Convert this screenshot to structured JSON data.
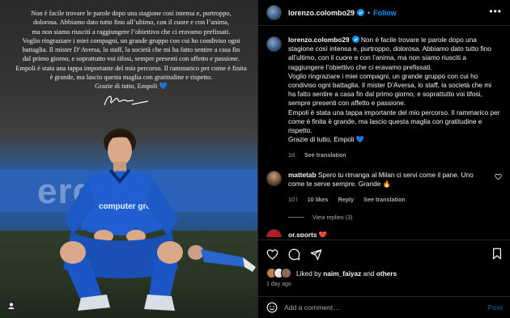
{
  "photo": {
    "overlay_text": "Non è facile trovare le parole dopo una stagione così intensa e, purtroppo,\ndolorosa. Abbiamo dato tutto fino all’ultimo, con il cuore e con l’anima,\nma non siamo riusciti a raggiungere l’obiettivo che ci eravamo prefissati.\nVoglio ringraziare i miei compagni, un grande gruppo con cui ho condiviso ogni\nbattaglia. Il mister D’Aversa, lo staff, la società che mi ha fatto sentire a casa fin\ndal primo giorno, e soprattutto voi tifosi, sempre presenti con affetto e passione.\nEmpoli è stata una tappa importante del mio percorso. Il rammarico per come è finita\nè grande, ma lascio questa maglia con gratitudine e rispetto.\nGrazie di tutto, Empoli 💙",
    "banner_text": "ergass",
    "shirt_sponsor": "computer gross"
  },
  "header": {
    "username": "lorenzo.colombo29",
    "separator": "•",
    "follow_label": "Follow",
    "more_label": "•••"
  },
  "caption": {
    "username": "lorenzo.colombo29",
    "text": "Non è facile trovare le parole dopo una stagione così intensa e, purtroppo, dolorosa. Abbiamo dato tutto fino all’ultimo, con il cuore e con l’anima, ma non siamo riusciti a raggiungere l’obiettivo che ci eravamo prefissati.\nVoglio ringraziare i miei compagni, un grande gruppo con cui ho condiviso ogni battaglia. Il mister D’Aversa, lo staff, la società che mi ha fatto sentire a casa fin dal primo giorno, e soprattutto voi tifosi, sempre presenti con affetto e passione.\nEmpoli è stata una tappa importante del mio percorso. Il rammarico per come è finita è grande, ma lascio questa maglia con gratitudine e rispetto.\nGrazie di tutto, Empoli 💙",
    "age": "1d",
    "see_translation": "See translation"
  },
  "comment": {
    "username": "mattetab",
    "text": "Spero tu rimanga al Milan ci servi come il pane. Uno come te serve sempre. Grande 🔥",
    "age": "10 l",
    "likes": "10 likes",
    "reply": "Reply",
    "see_translation": "See translation",
    "view_replies": "View replies (3)"
  },
  "next_comment": {
    "username": "or.sports ❤️"
  },
  "likes": {
    "prefix": "Liked by",
    "user": "naim_faiyaz",
    "mid": "and",
    "others": "others",
    "avatar_colors": [
      "#c77d4a",
      "#e8e8e8",
      "#8a6a55"
    ]
  },
  "post_age": "1 day ago",
  "add_comment": {
    "placeholder": "Add a comment…",
    "post_label": "Post"
  },
  "colors": {
    "accent": "#0095f6",
    "background": "#000000",
    "muted": "#a8a8a8"
  }
}
